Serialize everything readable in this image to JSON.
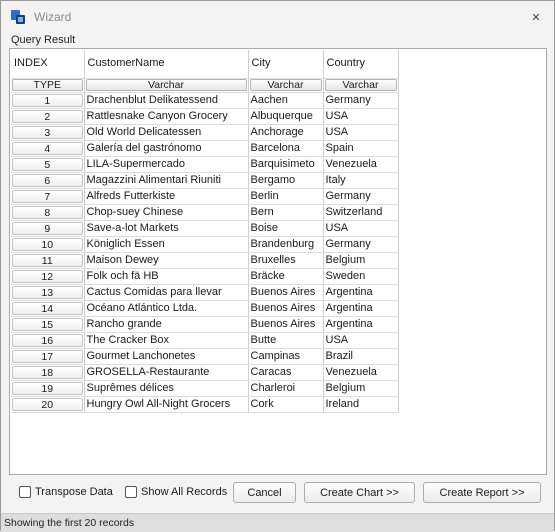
{
  "window": {
    "title": "Wizard",
    "close_glyph": "✕"
  },
  "query_result_label": "Query Result",
  "grid": {
    "columns": [
      "INDEX",
      "CustomerName",
      "City",
      "Country"
    ],
    "type_row": [
      "TYPE",
      "Varchar",
      "Varchar",
      "Varchar"
    ],
    "rows": [
      {
        "index": "1",
        "name": "Drachenblut Delikatessend",
        "city": "Aachen",
        "country": "Germany"
      },
      {
        "index": "2",
        "name": "Rattlesnake Canyon Grocery",
        "city": "Albuquerque",
        "country": "USA"
      },
      {
        "index": "3",
        "name": "Old World Delicatessen",
        "city": "Anchorage",
        "country": "USA"
      },
      {
        "index": "4",
        "name": "Galería del gastrónomo",
        "city": "Barcelona",
        "country": "Spain"
      },
      {
        "index": "5",
        "name": "LILA-Supermercado",
        "city": "Barquisimeto",
        "country": "Venezuela"
      },
      {
        "index": "6",
        "name": "Magazzini Alimentari Riuniti",
        "city": "Bergamo",
        "country": "Italy"
      },
      {
        "index": "7",
        "name": "Alfreds Futterkiste",
        "city": "Berlin",
        "country": "Germany"
      },
      {
        "index": "8",
        "name": "Chop-suey Chinese",
        "city": "Bern",
        "country": "Switzerland"
      },
      {
        "index": "9",
        "name": "Save-a-lot Markets",
        "city": "Boise",
        "country": "USA"
      },
      {
        "index": "10",
        "name": "Königlich Essen",
        "city": "Brandenburg",
        "country": "Germany"
      },
      {
        "index": "11",
        "name": "Maison Dewey",
        "city": "Bruxelles",
        "country": "Belgium"
      },
      {
        "index": "12",
        "name": "Folk och fä HB",
        "city": "Bräcke",
        "country": "Sweden"
      },
      {
        "index": "13",
        "name": "Cactus Comidas para llevar",
        "city": "Buenos Aires",
        "country": "Argentina"
      },
      {
        "index": "14",
        "name": "Océano Atlántico Ltda.",
        "city": "Buenos Aires",
        "country": "Argentina"
      },
      {
        "index": "15",
        "name": "Rancho grande",
        "city": "Buenos Aires",
        "country": "Argentina"
      },
      {
        "index": "16",
        "name": "The Cracker Box",
        "city": "Butte",
        "country": "USA"
      },
      {
        "index": "17",
        "name": "Gourmet Lanchonetes",
        "city": "Campinas",
        "country": "Brazil"
      },
      {
        "index": "18",
        "name": "GROSELLA-Restaurante",
        "city": "Caracas",
        "country": "Venezuela"
      },
      {
        "index": "19",
        "name": "Suprêmes délices",
        "city": "Charleroi",
        "country": "Belgium"
      },
      {
        "index": "20",
        "name": "Hungry Owl All-Night Grocers",
        "city": "Cork",
        "country": "Ireland"
      }
    ]
  },
  "options": {
    "transpose_label": "Transpose Data",
    "show_all_label": "Show All Records"
  },
  "buttons": {
    "cancel": "Cancel",
    "create_chart": "Create Chart >>",
    "create_report": "Create Report >>"
  },
  "status": "Showing the first 20 records",
  "colors": {
    "app_icon_blue": "#2a6fc9",
    "app_icon_dark": "#1f3f73"
  }
}
